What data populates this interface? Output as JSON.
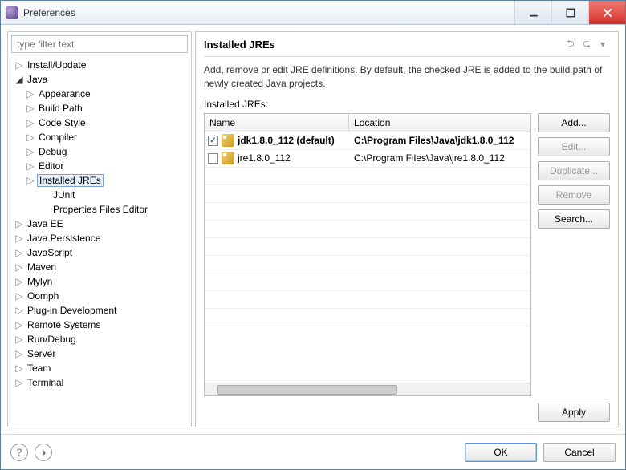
{
  "window": {
    "title": "Preferences"
  },
  "filter": {
    "placeholder": "type filter text"
  },
  "tree": [
    {
      "label": "Install/Update",
      "depth": 0,
      "expanded": false
    },
    {
      "label": "Java",
      "depth": 0,
      "expanded": true
    },
    {
      "label": "Appearance",
      "depth": 1,
      "expanded": false
    },
    {
      "label": "Build Path",
      "depth": 1,
      "expanded": false
    },
    {
      "label": "Code Style",
      "depth": 1,
      "expanded": false
    },
    {
      "label": "Compiler",
      "depth": 1,
      "expanded": false
    },
    {
      "label": "Debug",
      "depth": 1,
      "expanded": false
    },
    {
      "label": "Editor",
      "depth": 1,
      "expanded": false
    },
    {
      "label": "Installed JREs",
      "depth": 1,
      "expanded": false,
      "selected": true
    },
    {
      "label": "JUnit",
      "depth": 2,
      "leaf": true
    },
    {
      "label": "Properties Files Editor",
      "depth": 2,
      "leaf": true
    },
    {
      "label": "Java EE",
      "depth": 0,
      "expanded": false
    },
    {
      "label": "Java Persistence",
      "depth": 0,
      "expanded": false
    },
    {
      "label": "JavaScript",
      "depth": 0,
      "expanded": false
    },
    {
      "label": "Maven",
      "depth": 0,
      "expanded": false
    },
    {
      "label": "Mylyn",
      "depth": 0,
      "expanded": false
    },
    {
      "label": "Oomph",
      "depth": 0,
      "expanded": false
    },
    {
      "label": "Plug-in Development",
      "depth": 0,
      "expanded": false
    },
    {
      "label": "Remote Systems",
      "depth": 0,
      "expanded": false
    },
    {
      "label": "Run/Debug",
      "depth": 0,
      "expanded": false
    },
    {
      "label": "Server",
      "depth": 0,
      "expanded": false
    },
    {
      "label": "Team",
      "depth": 0,
      "expanded": false
    },
    {
      "label": "Terminal",
      "depth": 0,
      "expanded": false
    }
  ],
  "page": {
    "title": "Installed JREs",
    "description": "Add, remove or edit JRE definitions. By default, the checked JRE is added to the build path of newly created Java projects.",
    "table_label": "Installed JREs:",
    "columns": {
      "name": "Name",
      "location": "Location"
    },
    "rows": [
      {
        "checked": true,
        "bold": true,
        "name": "jdk1.8.0_112 (default)",
        "location": "C:\\Program Files\\Java\\jdk1.8.0_112"
      },
      {
        "checked": false,
        "bold": false,
        "name": "jre1.8.0_112",
        "location": "C:\\Program Files\\Java\\jre1.8.0_112"
      }
    ],
    "buttons": {
      "add": "Add...",
      "edit": "Edit...",
      "duplicate": "Duplicate...",
      "remove": "Remove",
      "search": "Search..."
    },
    "apply": "Apply"
  },
  "footer": {
    "ok": "OK",
    "cancel": "Cancel"
  }
}
